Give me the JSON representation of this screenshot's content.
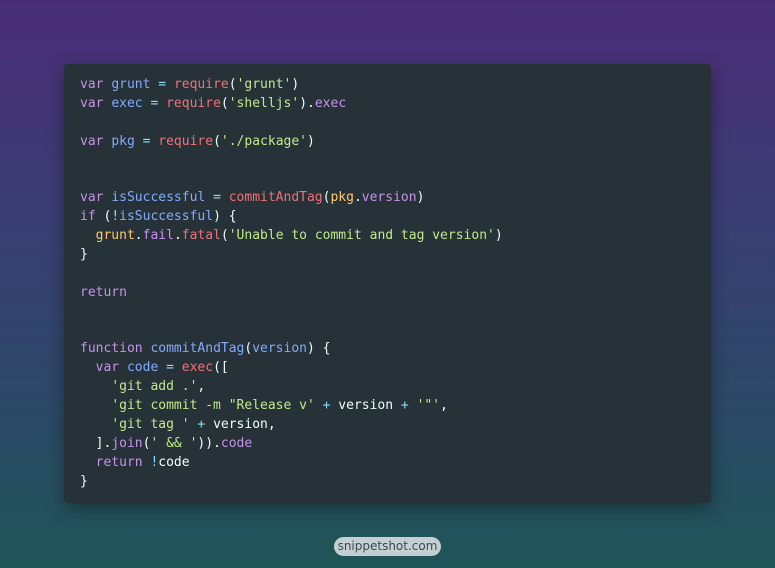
{
  "watermark": "snippetshot.com",
  "colors": {
    "background_top": "#4a2d78",
    "background_bottom": "#1f5556",
    "editor_bg": "#263238",
    "keyword": "#c792ea",
    "function_name": "#82aaff",
    "call": "#f07178",
    "string": "#c3e88d",
    "operator": "#89ddff",
    "object": "#ffcb6b",
    "plain": "#eeffff"
  },
  "code_lines": [
    [
      [
        "keyword",
        "var"
      ],
      [
        "plain",
        " "
      ],
      [
        "var",
        "grunt"
      ],
      [
        "plain",
        " "
      ],
      [
        "op",
        "="
      ],
      [
        "plain",
        " "
      ],
      [
        "call",
        "require"
      ],
      [
        "punct",
        "("
      ],
      [
        "string",
        "'grunt'"
      ],
      [
        "punct",
        ")"
      ]
    ],
    [
      [
        "keyword",
        "var"
      ],
      [
        "plain",
        " "
      ],
      [
        "var",
        "exec"
      ],
      [
        "plain",
        " "
      ],
      [
        "op",
        "="
      ],
      [
        "plain",
        " "
      ],
      [
        "call",
        "require"
      ],
      [
        "punct",
        "("
      ],
      [
        "string",
        "'shelljs'"
      ],
      [
        "punct",
        ")."
      ],
      [
        "prop",
        "exec"
      ]
    ],
    [],
    [
      [
        "keyword",
        "var"
      ],
      [
        "plain",
        " "
      ],
      [
        "var",
        "pkg"
      ],
      [
        "plain",
        " "
      ],
      [
        "op",
        "="
      ],
      [
        "plain",
        " "
      ],
      [
        "call",
        "require"
      ],
      [
        "punct",
        "("
      ],
      [
        "string",
        "'./package'"
      ],
      [
        "punct",
        ")"
      ]
    ],
    [],
    [],
    [
      [
        "keyword",
        "var"
      ],
      [
        "plain",
        " "
      ],
      [
        "var",
        "isSuccessful"
      ],
      [
        "plain",
        " "
      ],
      [
        "op",
        "="
      ],
      [
        "plain",
        " "
      ],
      [
        "call",
        "commitAndTag"
      ],
      [
        "punct",
        "("
      ],
      [
        "obj",
        "pkg"
      ],
      [
        "punct",
        "."
      ],
      [
        "prop",
        "version"
      ],
      [
        "punct",
        ")"
      ]
    ],
    [
      [
        "keyword",
        "if"
      ],
      [
        "plain",
        " "
      ],
      [
        "punct",
        "("
      ],
      [
        "op",
        "!"
      ],
      [
        "var",
        "isSuccessful"
      ],
      [
        "punct",
        ")"
      ],
      [
        "plain",
        " "
      ],
      [
        "punct",
        "{"
      ]
    ],
    [
      [
        "plain",
        "  "
      ],
      [
        "obj",
        "grunt"
      ],
      [
        "punct",
        "."
      ],
      [
        "prop",
        "fail"
      ],
      [
        "punct",
        "."
      ],
      [
        "call",
        "fatal"
      ],
      [
        "punct",
        "("
      ],
      [
        "string",
        "'Unable to commit and tag version'"
      ],
      [
        "punct",
        ")"
      ]
    ],
    [
      [
        "punct",
        "}"
      ]
    ],
    [],
    [
      [
        "keyword",
        "return"
      ]
    ],
    [],
    [],
    [
      [
        "keyword",
        "function"
      ],
      [
        "plain",
        " "
      ],
      [
        "func",
        "commitAndTag"
      ],
      [
        "punct",
        "("
      ],
      [
        "var",
        "version"
      ],
      [
        "punct",
        ")"
      ],
      [
        "plain",
        " "
      ],
      [
        "punct",
        "{"
      ]
    ],
    [
      [
        "plain",
        "  "
      ],
      [
        "keyword",
        "var"
      ],
      [
        "plain",
        " "
      ],
      [
        "var",
        "code"
      ],
      [
        "plain",
        " "
      ],
      [
        "op",
        "="
      ],
      [
        "plain",
        " "
      ],
      [
        "call",
        "exec"
      ],
      [
        "punct",
        "(["
      ]
    ],
    [
      [
        "plain",
        "    "
      ],
      [
        "string",
        "'git add .'"
      ],
      [
        "punct",
        ","
      ]
    ],
    [
      [
        "plain",
        "    "
      ],
      [
        "string",
        "'git commit -m \"Release v'"
      ],
      [
        "plain",
        " "
      ],
      [
        "op",
        "+"
      ],
      [
        "plain",
        " "
      ],
      [
        "plain",
        "version"
      ],
      [
        "plain",
        " "
      ],
      [
        "op",
        "+"
      ],
      [
        "plain",
        " "
      ],
      [
        "string",
        "'\"'"
      ],
      [
        "punct",
        ","
      ]
    ],
    [
      [
        "plain",
        "    "
      ],
      [
        "string",
        "'git tag '"
      ],
      [
        "plain",
        " "
      ],
      [
        "op",
        "+"
      ],
      [
        "plain",
        " "
      ],
      [
        "plain",
        "version"
      ],
      [
        "punct",
        ","
      ]
    ],
    [
      [
        "plain",
        "  "
      ],
      [
        "punct",
        "]."
      ],
      [
        "prop",
        "join"
      ],
      [
        "punct",
        "("
      ],
      [
        "string",
        "' && '"
      ],
      [
        "punct",
        "))."
      ],
      [
        "prop",
        "code"
      ]
    ],
    [
      [
        "plain",
        "  "
      ],
      [
        "keyword",
        "return"
      ],
      [
        "plain",
        " "
      ],
      [
        "op",
        "!"
      ],
      [
        "plain",
        "code"
      ]
    ],
    [
      [
        "punct",
        "}"
      ]
    ]
  ]
}
